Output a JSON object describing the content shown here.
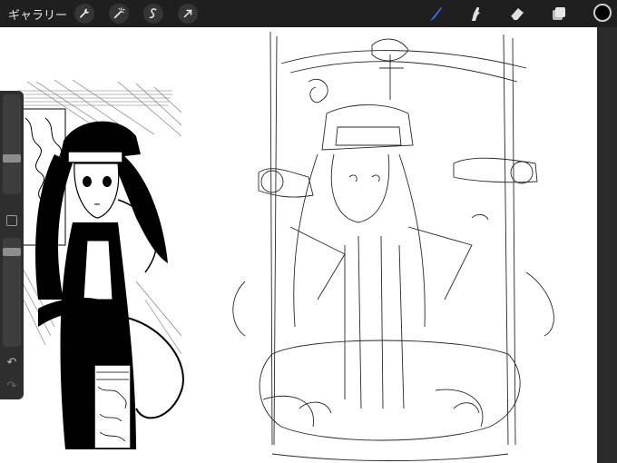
{
  "topbar": {
    "gallery_label": "ギャラリー",
    "left_tools": [
      "wrench-icon",
      "magic-wand-icon",
      "selection-icon",
      "transform-arrow-icon"
    ],
    "right_tools": [
      "brush-icon",
      "smudge-icon",
      "eraser-icon",
      "layers-icon"
    ],
    "active_tool": "brush-icon",
    "accent_color": "#2f6cf6",
    "current_color": "#000000"
  },
  "sidebar": {
    "brush_size_level": 0.35,
    "opacity_level": 0.1
  },
  "canvas": {
    "artwork": "sketch"
  }
}
